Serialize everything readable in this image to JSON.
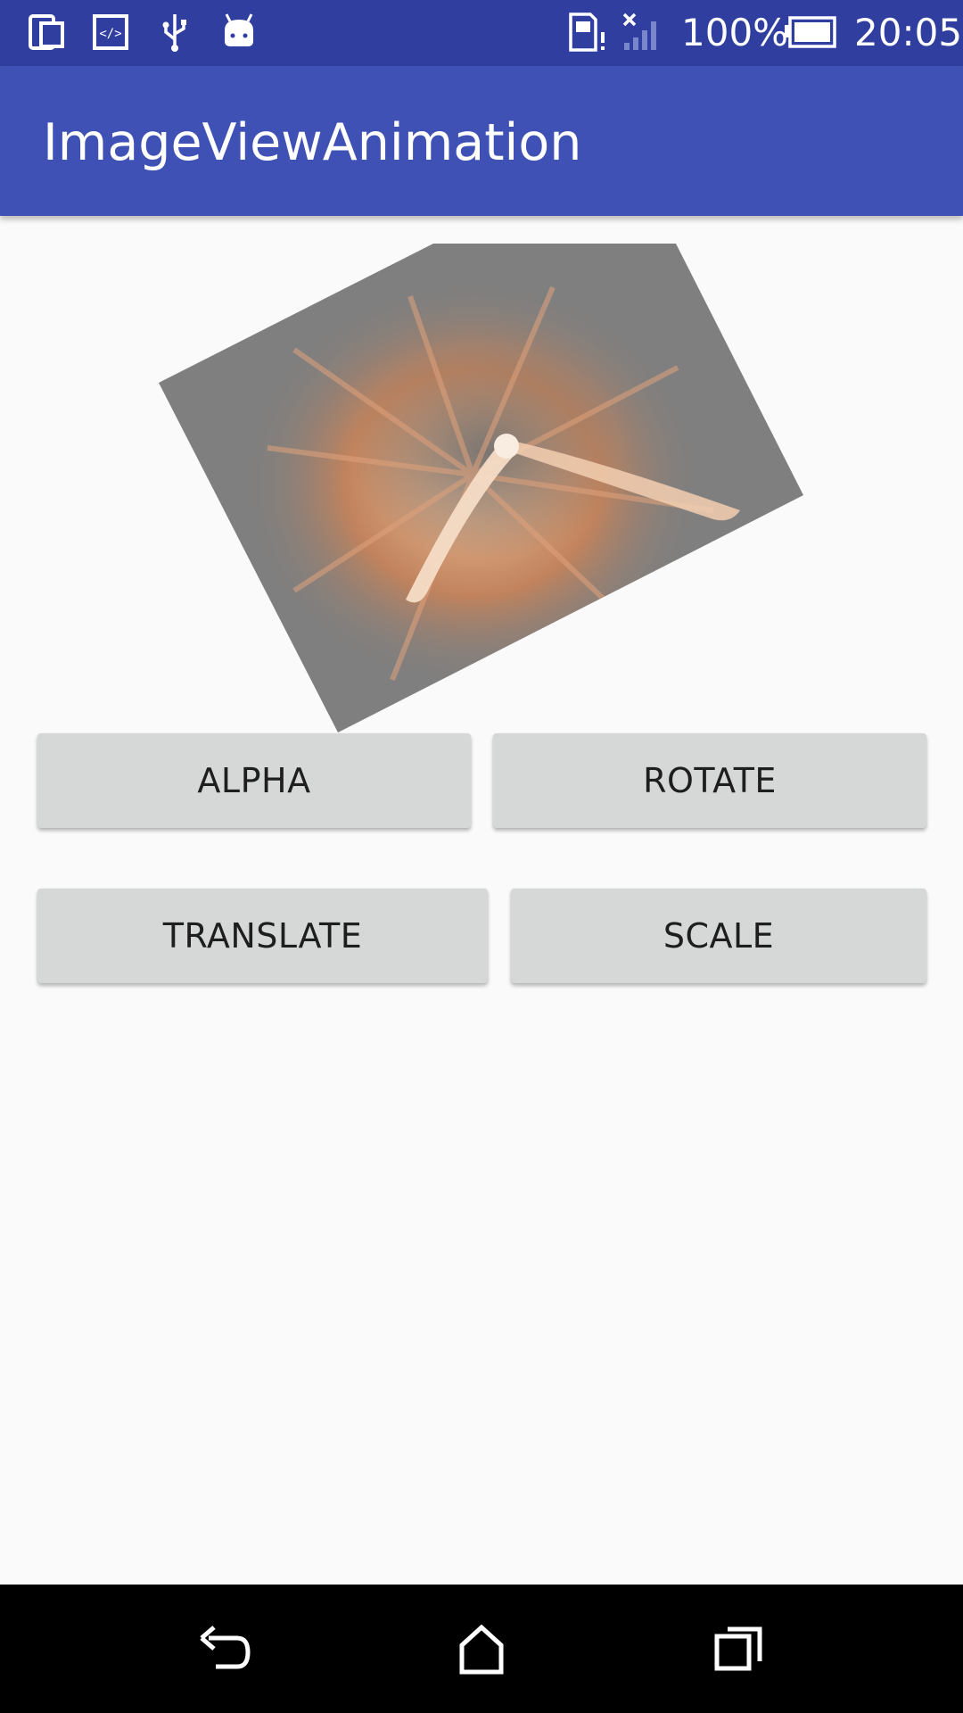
{
  "status_bar": {
    "icons": [
      "phone-tablet-icon",
      "code-icon",
      "usb-icon",
      "android-icon",
      "sim-alert-icon",
      "signal-no-service-icon",
      "battery-icon"
    ],
    "battery_percent": "100%",
    "time": "20:05"
  },
  "app_bar": {
    "title": "ImageViewAnimation"
  },
  "image": {
    "icon": "fire-burst-image",
    "tint": "#7f7f7f"
  },
  "buttons": {
    "alpha": "ALPHA",
    "rotate": "ROTATE",
    "translate": "TRANSLATE",
    "scale": "SCALE"
  },
  "nav_bar": {
    "icons": [
      "back-icon",
      "home-icon",
      "recents-icon"
    ]
  },
  "colors": {
    "status_bar": "#303f9f",
    "app_bar": "#3f51b5",
    "background": "#fafafa",
    "button": "#d6d7d7",
    "nav_bar": "#000000"
  }
}
